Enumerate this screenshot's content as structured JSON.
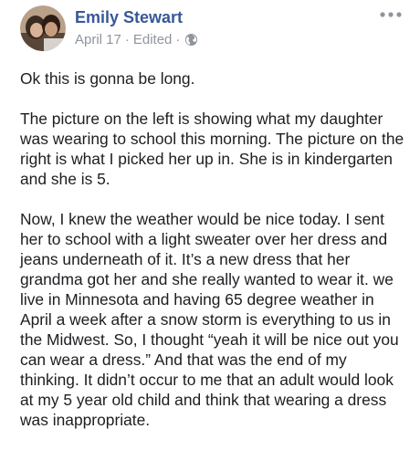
{
  "post": {
    "author": "Emily Stewart",
    "date": "April 17",
    "separator1": "·",
    "edited": "Edited",
    "separator2": "·",
    "privacy_icon": "globe-icon",
    "more_icon": "more-options-icon",
    "paragraphs": [
      "Ok this is gonna be long.",
      "The picture on the left is showing what my daughter was wearing to school this morning. The picture on the right is what I picked her up in. She is in kindergarten and she is 5.",
      "Now, I knew the weather would be nice today. I sent her to school with a light sweater over her dress and jeans underneath of it. It’s a new dress that her grandma got her and she really wanted to wear it. we live in Minnesota and having 65 degree weather in April a week after a snow storm is everything to us in the Midwest. So, I thought “yeah it will be nice out you can wear a dress.” And that was the end of my thinking. It didn’t occur to me that an adult would look at my 5 year old child and think that wearing a dress was inappropriate."
    ]
  },
  "colors": {
    "author_link": "#385898",
    "meta_text": "#90949c",
    "body_text": "#1c1e21"
  }
}
